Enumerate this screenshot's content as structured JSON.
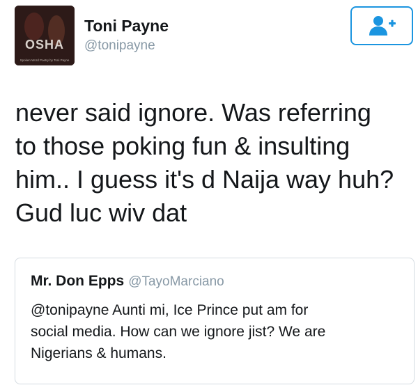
{
  "author": {
    "name": "Toni Payne",
    "handle": "@tonipayne",
    "avatar_title": "OSHA",
    "avatar_caption": "Spoken Word Poetry by Toni Payne"
  },
  "follow_button": {
    "icon": "person-plus-icon",
    "color": "#1b95e0"
  },
  "tweet": {
    "lines": [
      "never said ignore. Was referring",
      "to those poking fun & insulting",
      "him.. I guess it's d Naija way huh?",
      "Gud luc wiv dat"
    ]
  },
  "quoted_tweet": {
    "name": "Mr. Don Epps",
    "handle": "@TayoMarciano",
    "lines": [
      "@tonipayne Aunti mi, Ice Prince put am for",
      "social media. How can we ignore jist? We are",
      "Nigerians & humans."
    ]
  },
  "colors": {
    "accent": "#1b95e0",
    "secondary_text": "#8899a6",
    "border": "#d4dbe1"
  }
}
